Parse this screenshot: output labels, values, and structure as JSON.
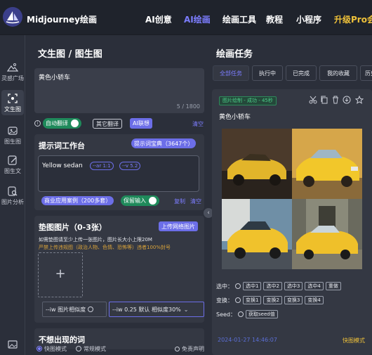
{
  "header": {
    "brand": "Midjourney绘画",
    "nav": [
      "AI创意",
      "AI绘画",
      "绘画工具",
      "教程",
      "小程序",
      "升级Pro会员"
    ]
  },
  "sidebar": {
    "items": [
      {
        "label": "灵感广场",
        "icon": "mountain-icon"
      },
      {
        "label": "文生图",
        "icon": "image-scan-icon"
      },
      {
        "label": "图生图",
        "icon": "picture-icon"
      },
      {
        "label": "图生文",
        "icon": "edit-icon"
      },
      {
        "label": "图片分析",
        "icon": "analysis-icon"
      },
      {
        "label": "",
        "icon": "gallery-icon"
      }
    ]
  },
  "generator": {
    "title": "文生图 / 图生图",
    "prompt_value": "黄色小轿车",
    "char_count": "5 / 1800",
    "auto_translate": "自动翻译",
    "other_translate": "其它翻译",
    "ai_assoc": "AI联想",
    "clear": "清空"
  },
  "keywords": {
    "title": "提示词工作台",
    "dict_button": "提示词宝典（3647个）",
    "text": "Yellow sedan",
    "chips": [
      "--ar 1:1",
      "--v 5.2"
    ],
    "cases_button": "商业应用案例（200多套）",
    "keep_input": "保留输入",
    "copy": "复制",
    "clear": "清空"
  },
  "pad_images": {
    "title": "垫图图片（0-3张）",
    "upload_network": "上传网络图片",
    "hint1": "如需垫图请至少上传一张图片，图片长大小上限20M",
    "hint2": "严禁上传违规图（政治人物、色情、恐怖等）违者100%封号",
    "add_symbol": "+",
    "iw_label": "--iw 图片相似度",
    "iw_value": "--iw 0.25 默认 相似度30%"
  },
  "negative": {
    "title": "不想出现的词"
  },
  "footer": {
    "fast_mode": "快图模式",
    "normal_mode": "常规模式",
    "disclaimer": "免责声明"
  },
  "tasks": {
    "title": "绘画任务",
    "tabs": [
      "全部任务",
      "执行中",
      "已完成",
      "我的收藏",
      "历史"
    ],
    "active_tab": 0,
    "card": {
      "status": "图片绘制 - 成功 - 45秒",
      "prompt": "黄色小轿车",
      "select_label": "选中：",
      "select_buttons": [
        "选中1",
        "选中2",
        "选中3",
        "选中4",
        "重做"
      ],
      "change_label": "变换：",
      "change_buttons": [
        "变换1",
        "变换2",
        "变换3",
        "变换4"
      ],
      "seed_label": "Seed：",
      "seed_button": "获取seed值",
      "time": "2024-01-27 14:46:07",
      "mode": "快图模式"
    }
  },
  "colors": {
    "accent": "#7c7dff",
    "success": "#4cd08a",
    "pro": "#f0c23a",
    "background": "#2b2f3a"
  }
}
